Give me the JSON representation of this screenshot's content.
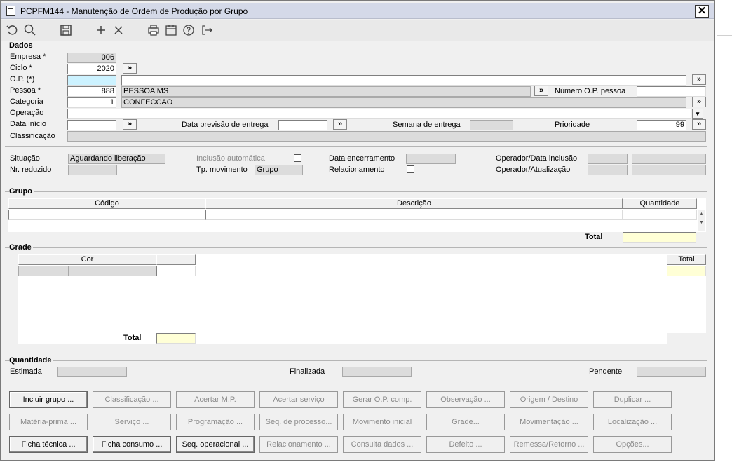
{
  "window": {
    "title": "PCPFM144 - Manutenção de Ordem de Produção por Grupo",
    "close": "✕"
  },
  "toolbar": {
    "icons": [
      "undo-icon",
      "search-icon",
      "save-icon",
      "add-icon",
      "delete-icon",
      "print-icon",
      "calendar-icon",
      "help-icon",
      "exit-icon"
    ]
  },
  "dados": {
    "title": "Dados",
    "empresa": {
      "label": "Empresa *",
      "value": "006"
    },
    "ciclo": {
      "label": "Ciclo *",
      "value": "2020",
      "lookup": "»"
    },
    "op": {
      "label": "O.P. (*)",
      "value": "",
      "lookup": "»"
    },
    "pessoa": {
      "label": "Pessoa *",
      "value": "888",
      "name": "PESSOA MS",
      "lookup": "»",
      "num_op_label": "Número O.P. pessoa",
      "num_op_value": ""
    },
    "categoria": {
      "label": "Categoria",
      "value": "1",
      "name": "CONFECCAO",
      "lookup": "»"
    },
    "operacao": {
      "label": "Operação",
      "value": "",
      "dropdown": "▾"
    },
    "data_inicio": {
      "label": "Data início",
      "value": "",
      "lookup": "»"
    },
    "data_previsao": {
      "label": "Data previsão de entrega",
      "value": "",
      "lookup": "»"
    },
    "semana": {
      "label": "Semana de entrega",
      "value": ""
    },
    "prioridade": {
      "label": "Prioridade",
      "value": "99",
      "lookup": "»"
    },
    "classificacao": {
      "label": "Classificação",
      "value": ""
    }
  },
  "status": {
    "situacao": {
      "label": "Situação",
      "value": "Aguardando liberação"
    },
    "nr_reduzido": {
      "label": "Nr. reduzido",
      "value": ""
    },
    "inclusao_auto": {
      "label": "Inclusão automática",
      "checked": false
    },
    "tp_movimento": {
      "label": "Tp. movimento",
      "value": "Grupo"
    },
    "data_encerramento": {
      "label": "Data encerramento",
      "value": ""
    },
    "relacionamento": {
      "label": "Relacionamento",
      "checked": false
    },
    "op_data_inclusao": {
      "label": "Operador/Data inclusão",
      "value1": "",
      "value2": ""
    },
    "op_atualizacao": {
      "label": "Operador/Atualização",
      "value1": "",
      "value2": ""
    }
  },
  "grupo": {
    "title": "Grupo",
    "columns": [
      "Código",
      "Descrição",
      "Quantidade"
    ],
    "rows": [
      [
        "",
        "",
        ""
      ]
    ],
    "total_label": "Total",
    "total_value": ""
  },
  "grade": {
    "title": "Grade",
    "columns": [
      "Cor",
      ""
    ],
    "total_col": "Total",
    "total_label": "Total",
    "total_value": ""
  },
  "quantidade": {
    "title": "Quantidade",
    "estimada": {
      "label": "Estimada",
      "value": ""
    },
    "finalizada": {
      "label": "Finalizada",
      "value": ""
    },
    "pendente": {
      "label": "Pendente",
      "value": ""
    }
  },
  "buttons": {
    "row1": [
      {
        "label": "Incluir grupo ...",
        "enabled": true
      },
      {
        "label": "Classificação ...",
        "enabled": false
      },
      {
        "label": "Acertar M.P.",
        "enabled": false
      },
      {
        "label": "Acertar serviço",
        "enabled": false
      },
      {
        "label": "Gerar O.P. comp.",
        "enabled": false
      },
      {
        "label": "Observação ...",
        "enabled": false
      },
      {
        "label": "Origem / Destino",
        "enabled": false
      },
      {
        "label": "Duplicar ...",
        "enabled": false
      }
    ],
    "row2": [
      {
        "label": "Matéria-prima ...",
        "enabled": false
      },
      {
        "label": "Serviço ...",
        "enabled": false
      },
      {
        "label": "Programação ...",
        "enabled": false
      },
      {
        "label": "Seq. de processo...",
        "enabled": false
      },
      {
        "label": "Movimento inicial",
        "enabled": false
      },
      {
        "label": "Grade...",
        "enabled": false
      },
      {
        "label": "Movimentação ...",
        "enabled": false
      },
      {
        "label": "Localização ...",
        "enabled": false
      }
    ],
    "row3": [
      {
        "label": "Ficha técnica ...",
        "enabled": true
      },
      {
        "label": "Ficha consumo ...",
        "enabled": true
      },
      {
        "label": "Seq. operacional ...",
        "enabled": true
      },
      {
        "label": "Relacionamento ...",
        "enabled": false
      },
      {
        "label": "Consulta dados ...",
        "enabled": false
      },
      {
        "label": "Defeito ...",
        "enabled": false
      },
      {
        "label": "Remessa/Retorno ...",
        "enabled": false
      },
      {
        "label": "Opções...",
        "enabled": false
      }
    ]
  }
}
